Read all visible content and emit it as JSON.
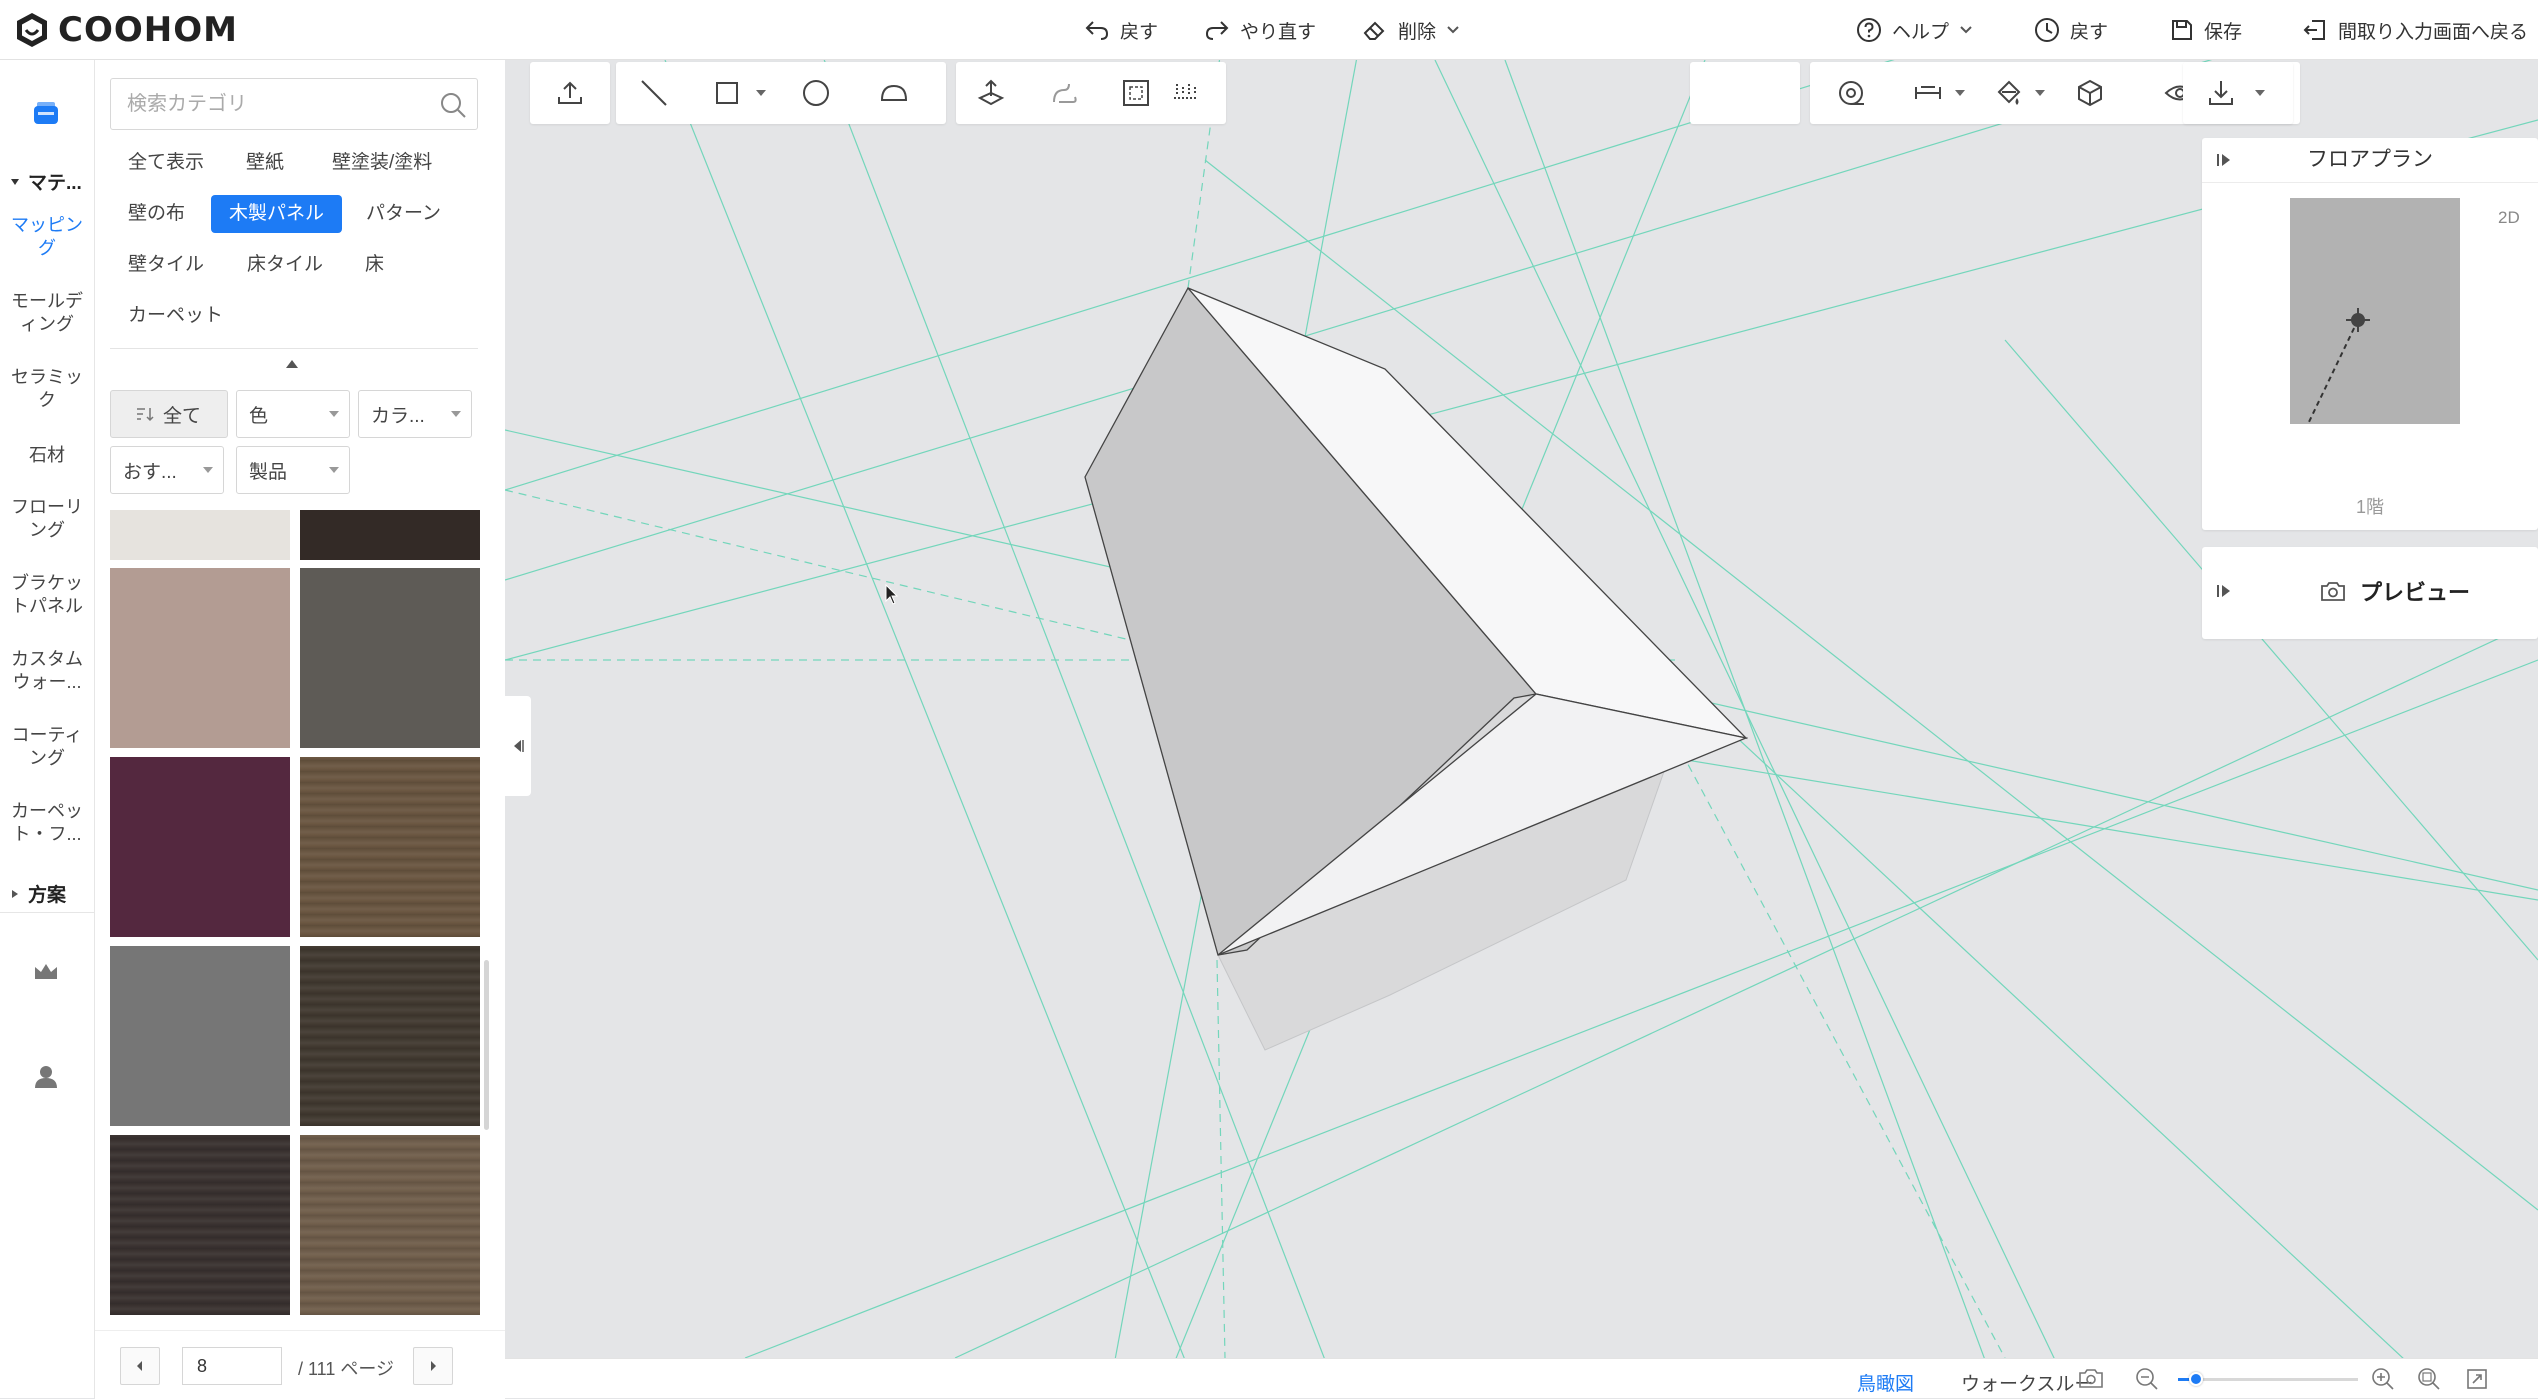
{
  "app": {
    "logo_text": "COOHOM"
  },
  "toolbar": {
    "undo": "戻す",
    "redo": "やり直す",
    "delete": "削除",
    "help": "ヘルプ",
    "history": "戻す",
    "save": "保存",
    "back_to_floorplan": "間取り入力画面へ戻る"
  },
  "rail": {
    "section_materials": "マテ...",
    "items": [
      "マッピング",
      "モールディング",
      "セラミック",
      "石材",
      "フローリング",
      "ブラケットパネル",
      "カスタムウォー...",
      "コーティング",
      "カーペット・フ..."
    ],
    "section_plans": "方案",
    "active_index": 0
  },
  "catalog": {
    "search_placeholder": "検索カテゴリ",
    "categories": [
      "全て表示",
      "壁紙",
      "壁塗装/塗料",
      "壁の布",
      "木製パネル",
      "パターン",
      "壁タイル",
      "床タイル",
      "床",
      "カーペット"
    ],
    "active_category": "木製パネル",
    "filters": {
      "all": "全て",
      "color": "色",
      "color_series": "カラ...",
      "recommended": "おす...",
      "product": "製品"
    },
    "swatch_colors": [
      "#e6e3de",
      "#332a26",
      "#b39c93",
      "#5e5b56",
      "#54283f",
      "#6a5641",
      "#767676",
      "#423a31",
      "#3a3230",
      "#705e4b"
    ],
    "pager": {
      "current": "8",
      "total_text": "/ 111 ページ"
    }
  },
  "viewport": {
    "floorplan_title": "フロアプラン",
    "floorplan_view": "2D",
    "floor_label": "1階",
    "preview_label": "プレビュー"
  },
  "bottom": {
    "view_bird": "鳥瞰図",
    "view_walkthrough": "ウォークスルー",
    "zoom_level": 0.1
  },
  "colors": {
    "accent": "#1d7bf5",
    "guide_line": "#6fd4b8"
  }
}
